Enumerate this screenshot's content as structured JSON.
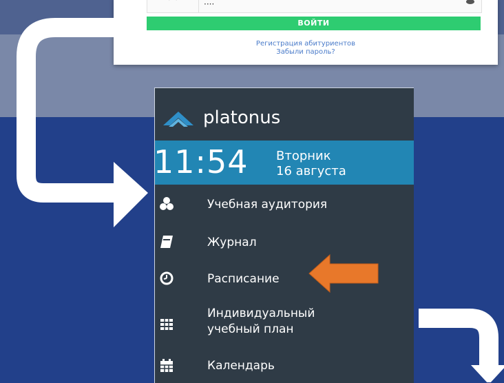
{
  "login": {
    "password_value": "····",
    "login_button": "ВОЙТИ",
    "register_link": "Регистрация абитуриентов",
    "forgot_link": "Забыли пароль?"
  },
  "sidebar": {
    "brand": "platonus",
    "clock": {
      "time": "11:54",
      "weekday": "Вторник",
      "date": "16 августа"
    },
    "items": [
      {
        "label": "Учебная аудитория",
        "icon": "cubes-icon"
      },
      {
        "label": "Журнал",
        "icon": "book-icon"
      },
      {
        "label": "Расписание",
        "icon": "clock-icon"
      },
      {
        "label": "Индивидуальный учебный план",
        "line1": "Индивидуальный",
        "line2": "учебный план",
        "icon": "grid-icon"
      },
      {
        "label": "Календарь",
        "icon": "calendar-icon"
      }
    ]
  },
  "colors": {
    "background": "#22408a",
    "sidebar": "#2f3b46",
    "clock_band": "#2286b4",
    "login_button": "#2ecc71",
    "pointer_arrow": "#e8782a"
  }
}
